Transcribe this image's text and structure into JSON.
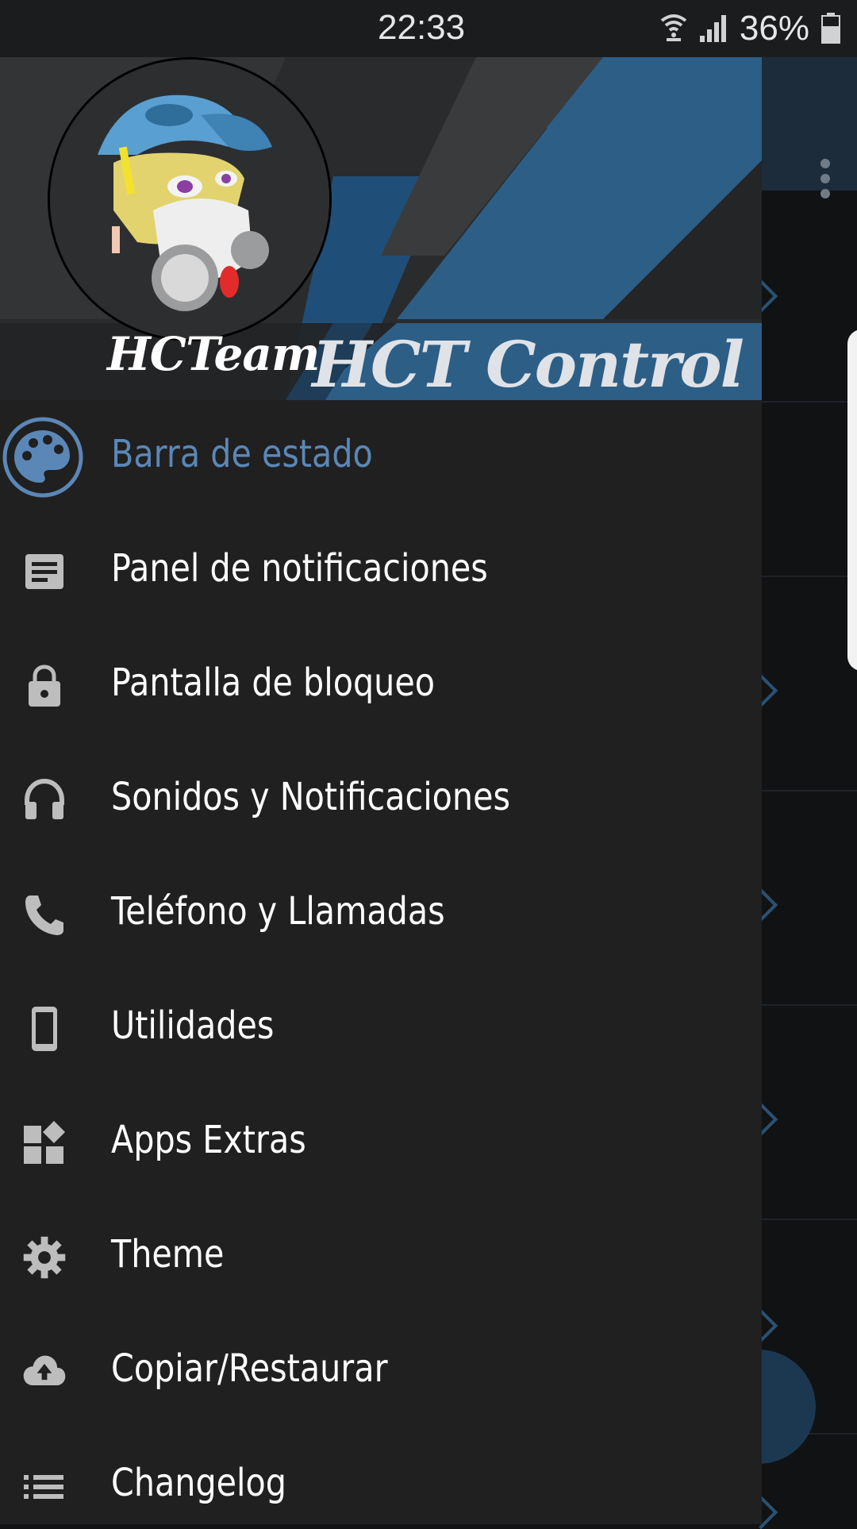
{
  "status_bar": {
    "time": "22:33",
    "battery": "36%",
    "icons": [
      "wifi-icon",
      "signal-icon",
      "battery-icon"
    ]
  },
  "drawer": {
    "header": {
      "left_label": "HCTeam",
      "right_label": "HCT Control"
    },
    "items": [
      {
        "label": "Barra de estado",
        "icon": "palette-icon",
        "active": true
      },
      {
        "label": "Panel de notificaciones",
        "icon": "notes-icon"
      },
      {
        "label": "Pantalla de bloqueo",
        "icon": "lock-icon"
      },
      {
        "label": "Sonidos y Notificaciones",
        "icon": "headphones-icon"
      },
      {
        "label": "Teléfono y Llamadas",
        "icon": "phone-icon"
      },
      {
        "label": "Utilidades",
        "icon": "smartphone-icon"
      },
      {
        "label": "Apps Extras",
        "icon": "widgets-icon"
      },
      {
        "label": "Theme",
        "icon": "gear-icon"
      },
      {
        "label": "Copiar/Restaurar",
        "icon": "cloud-upload-icon"
      },
      {
        "label": "Changelog",
        "icon": "list-icon"
      }
    ]
  },
  "colors": {
    "accent": "#5b87b6",
    "drawer_bg": "#202021",
    "header_blue": "#2d5e86"
  }
}
